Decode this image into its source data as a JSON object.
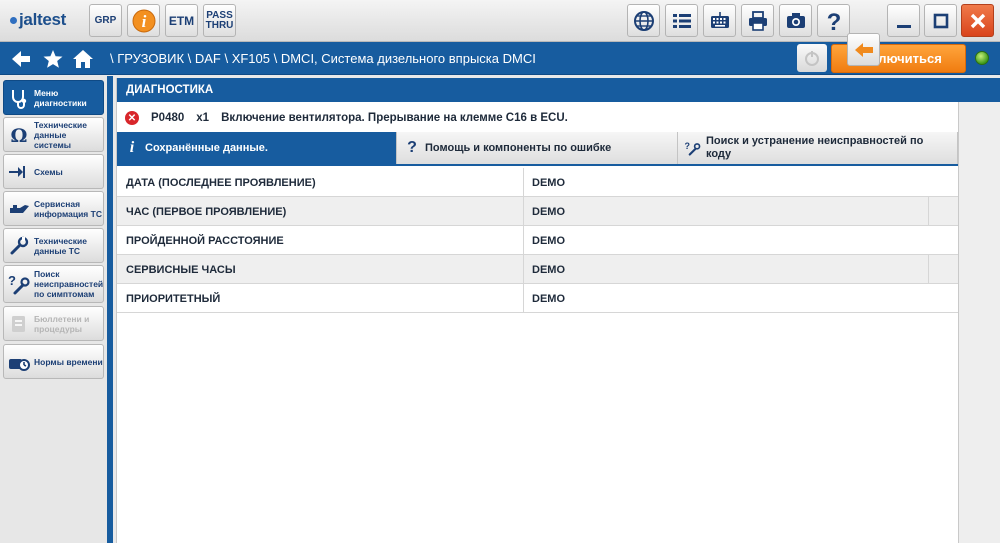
{
  "app": {
    "logo_text": "jaltest",
    "grp_label": "GRP",
    "etm_label": "ETM",
    "pass_label_1": "PASS",
    "pass_label_2": "THRU"
  },
  "navbar": {
    "breadcrumb": "\\ ГРУЗОВИК \\ DAF \\ XF105 \\ DMCI, Система дизельного впрыска DMCI",
    "disconnect_label": "Отключиться"
  },
  "sidebar": {
    "items": [
      {
        "label_1": "Меню",
        "label_2": "диагностики",
        "icon": "stethoscope-icon",
        "state": "active"
      },
      {
        "label_1": "Технические",
        "label_2": "данные системы",
        "icon": "omega-icon",
        "state": "normal"
      },
      {
        "label_1": "Схемы",
        "label_2": "",
        "icon": "schematic-icon",
        "state": "normal"
      },
      {
        "label_1": "Сервисная",
        "label_2": "информация ТС",
        "icon": "oil-can-icon",
        "state": "normal"
      },
      {
        "label_1": "Технические",
        "label_2": "данные ТС",
        "icon": "wrench-icon",
        "state": "normal"
      },
      {
        "label_1": "Поиск",
        "label_2": "неисправностей",
        "label_3": "по симптомам",
        "icon": "troubleshoot-icon",
        "state": "normal"
      },
      {
        "label_1": "Бюллетени и",
        "label_2": "процедуры",
        "icon": "bulletin-icon",
        "state": "disabled"
      },
      {
        "label_1": "Нормы времени",
        "label_2": "",
        "icon": "labour-time-icon",
        "state": "normal"
      }
    ]
  },
  "main": {
    "section_title": "ДИАГНОСТИКА",
    "error": {
      "code": "P0480",
      "count": "x1",
      "description": "Включение вентилятора. Прерывание на клемме C16 в ECU."
    },
    "tabs": [
      {
        "label": "Сохранённые данные.",
        "icon": "info-icon",
        "glyph": "i",
        "active": true
      },
      {
        "label": "Помощь и компоненты по ошибке",
        "icon": "help-icon",
        "glyph": "?",
        "active": false
      },
      {
        "label_1": "Поиск и устранение неисправностей по",
        "label_2": "коду",
        "icon": "troubleshoot-code-icon",
        "glyph": "?",
        "active": false
      }
    ],
    "rows": [
      {
        "name": "ДАТА (ПОСЛЕДНЕЕ ПРОЯВЛЕНИЕ)",
        "value": "DEMO"
      },
      {
        "name": "ЧАС  (ПЕРВОЕ ПРОЯВЛЕНИЕ)",
        "value": "DEMO"
      },
      {
        "name": "ПРОЙДЕННОЙ РАССТОЯНИЕ",
        "value": "DEMO"
      },
      {
        "name": "СЕРВИСНЫЕ ЧАСЫ",
        "value": "DEMO"
      },
      {
        "name": "ПРИОРИТЕТНЫЙ",
        "value": "DEMO"
      }
    ]
  },
  "toolbar_icons": [
    "grp-icon",
    "info-icon",
    "etm-icon",
    "pass-thru-icon",
    "globe-icon",
    "list-icon",
    "keyboard-icon",
    "print-icon",
    "camera-icon",
    "help-icon",
    "minimize-icon",
    "maximize-icon",
    "close-icon"
  ],
  "colors": {
    "primary_blue": "#175c9f",
    "accent_orange": "#f08a1e",
    "error_red": "#d8262b",
    "close_red": "#e0512a"
  }
}
